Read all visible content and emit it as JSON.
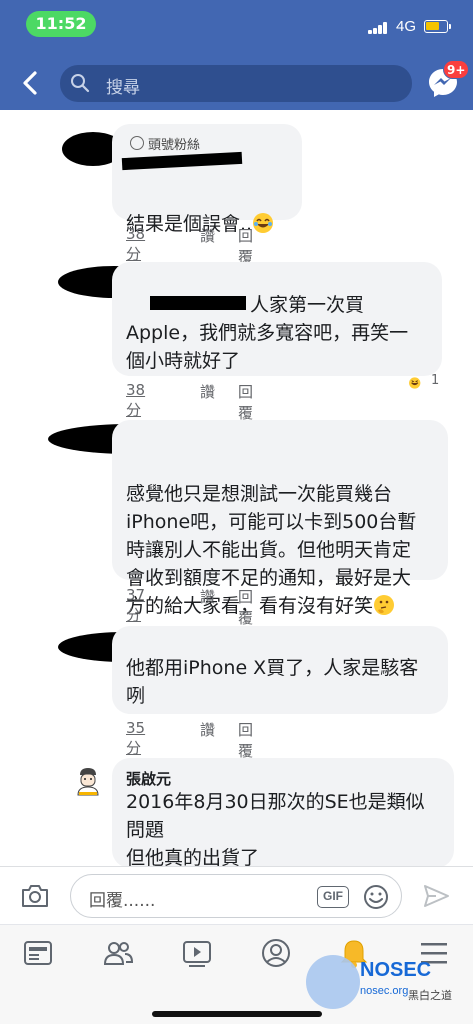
{
  "status_bar": {
    "time": "11:52",
    "network": "4G"
  },
  "header": {
    "search_placeholder": "搜尋",
    "messenger_badge": "9+"
  },
  "comments": [
    {
      "badge": "頭號粉絲",
      "text": "結果是個誤會..",
      "emoji": "joy-emoji",
      "time": "38分鐘",
      "like": "讚",
      "reply": "回覆"
    },
    {
      "text": "人家第一次買\nApple，我們就多寬容吧，再笑一\n個小時就好了",
      "time": "38分鐘",
      "like": "讚",
      "reply": "回覆",
      "reaction_count": "1"
    },
    {
      "text": "感覺他只是想測試一次能買幾台\niPhone吧，可能可以卡到500台暫\n時讓別人不能出貨。但他明天肯定\n會收到額度不足的通知，最好是大\n方的給大家看，看有沒有好笑",
      "emoji": "thinking-emoji",
      "time": "37分鐘",
      "like": "讚",
      "reply": "回覆"
    },
    {
      "text": "他都用iPhone X買了，人家是駭客\n咧",
      "time": "35分鐘",
      "like": "讚",
      "reply": "回覆"
    },
    {
      "author": "張啟元",
      "text": "2016年8月30日那次的SE也是類似\n問題\n但他真的出貨了"
    }
  ],
  "reply_bar": {
    "placeholder": "回覆......",
    "gif_label": "GIF"
  },
  "watermark": {
    "title": "NOSEC",
    "subtitle": "nosec.org",
    "note": "黑白之道"
  },
  "colors": {
    "header": "#4267b2",
    "bubble": "#f2f3f5",
    "badge": "#fa3e3e",
    "time_pill": "#4cd964"
  }
}
